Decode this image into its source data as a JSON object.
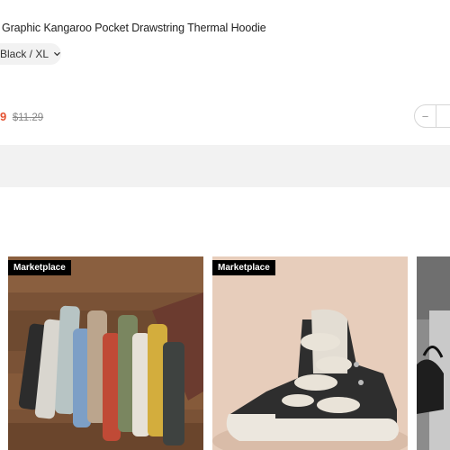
{
  "product": {
    "title": "Graphic Kangaroo Pocket Drawstring Thermal Hoodie",
    "variant": "Black / XL",
    "price_current": "9",
    "price_original": "$11.29"
  },
  "quantity": {
    "minus_symbol": "−"
  },
  "recommendations": [
    {
      "badge": "Marketplace",
      "image": "socks-photo"
    },
    {
      "badge": "Marketplace",
      "image": "high-top-sneaker-photo"
    },
    {
      "image": "handbag-photo"
    }
  ],
  "colors": {
    "price": "#e4502f",
    "chip_bg": "#f2f2f2",
    "band_bg": "#f2f2f2",
    "badge_bg": "#000000"
  }
}
